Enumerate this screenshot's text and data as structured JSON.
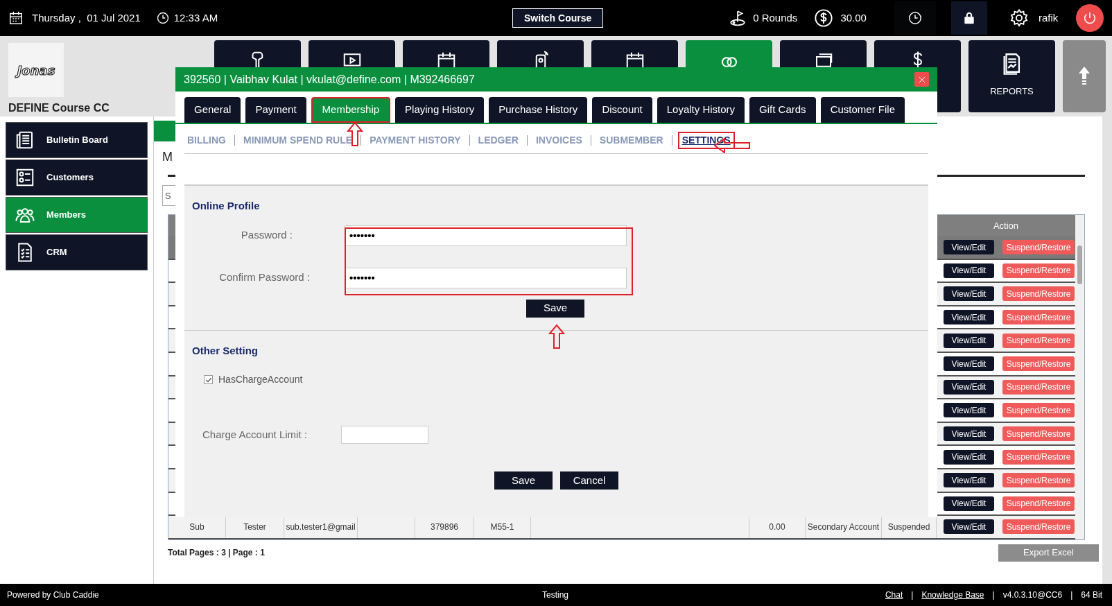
{
  "top_bar": {
    "date": "Thursday ,  01 Jul 2021",
    "time": "12:33 AM",
    "switch_button": "Switch Course",
    "rounds": "0 Rounds",
    "balance": "30.00",
    "user": "rafik"
  },
  "brand": {
    "logo": "Jonas",
    "course_name": "DEFINE Course CC"
  },
  "tiles": [
    {
      "kind": "scanner",
      "selected": false
    },
    {
      "kind": "screen",
      "selected": false
    },
    {
      "kind": "calendar",
      "selected": false
    },
    {
      "kind": "phone",
      "selected": false
    },
    {
      "kind": "calendar",
      "selected": false
    },
    {
      "kind": "rings",
      "selected": true
    },
    {
      "kind": "card",
      "selected": false
    },
    {
      "kind": "dollar",
      "selected": false
    },
    {
      "kind": "reports",
      "label": "REPORTS",
      "selected": false
    }
  ],
  "sidebar": {
    "items": [
      {
        "kind": "board",
        "label": "Bulletin Board",
        "selected": false
      },
      {
        "kind": "customers",
        "label": "Customers",
        "selected": false
      },
      {
        "kind": "members",
        "label": "Members",
        "selected": true
      },
      {
        "kind": "crm",
        "label": "CRM",
        "selected": false
      }
    ]
  },
  "page": {
    "heading": "M",
    "search": {
      "placeholder": "S"
    },
    "table": {
      "action_header": "Action",
      "rows": [
        {
          "selected": true,
          "actions": [
            "View/Edit",
            "Suspend/Restore"
          ]
        },
        {
          "selected": false,
          "actions": [
            "View/Edit",
            "Suspend/Restore"
          ]
        },
        {
          "selected": false,
          "actions": [
            "View/Edit",
            "Suspend/Restore"
          ]
        },
        {
          "selected": false,
          "actions": [
            "View/Edit",
            "Suspend/Restore"
          ]
        },
        {
          "selected": false,
          "actions": [
            "View/Edit",
            "Suspend/Restore"
          ]
        },
        {
          "selected": false,
          "actions": [
            "View/Edit",
            "Suspend/Restore"
          ]
        },
        {
          "selected": false,
          "actions": [
            "View/Edit",
            "Suspend/Restore"
          ]
        },
        {
          "selected": false,
          "actions": [
            "View/Edit",
            "Suspend/Restore"
          ]
        },
        {
          "selected": false,
          "actions": [
            "View/Edit",
            "Suspend/Restore"
          ]
        },
        {
          "selected": false,
          "actions": [
            "View/Edit",
            "Suspend/Restore"
          ]
        },
        {
          "selected": false,
          "actions": [
            "View/Edit",
            "Suspend/Restore"
          ]
        },
        {
          "selected": false,
          "actions": [
            "View/Edit",
            "Suspend/Restore"
          ]
        },
        {
          "selected": false,
          "cells": [
            "Sub",
            "Tester",
            "sub.tester1@gmail",
            null,
            "379896",
            "M55-1",
            null,
            "0.00",
            "Secondary Account",
            "Suspended"
          ],
          "actions": [
            "View/Edit",
            "Suspend/Restore"
          ]
        }
      ]
    },
    "pager": "Total Pages : 3 | Page : 1",
    "export_button": "Export Excel"
  },
  "modal": {
    "title": "392560 | Vaibhav Kulat | vkulat@define.com | M392466697",
    "tabs": [
      {
        "label": "General",
        "selected": false
      },
      {
        "label": "Payment",
        "selected": false
      },
      {
        "label": "Membership",
        "selected": true
      },
      {
        "label": "Playing History",
        "selected": false
      },
      {
        "label": "Purchase History",
        "selected": false
      },
      {
        "label": "Discount",
        "selected": false
      },
      {
        "label": "Loyalty History",
        "selected": false
      },
      {
        "label": "Gift Cards",
        "selected": false
      },
      {
        "label": "Customer File",
        "selected": false
      }
    ],
    "subtabs": [
      {
        "label": "BILLING",
        "selected": false
      },
      {
        "label": "MINIMUM SPEND RULE",
        "selected": false
      },
      {
        "label": "PAYMENT HISTORY",
        "selected": false
      },
      {
        "label": "LEDGER",
        "selected": false
      },
      {
        "label": "INVOICES",
        "selected": false
      },
      {
        "label": "SUBMEMBER",
        "selected": false
      },
      {
        "label": "SETTINGS",
        "selected": true
      }
    ],
    "online_profile": {
      "heading": "Online Profile",
      "password_label": "Password :",
      "password_value": "•••••••",
      "confirm_label": "Confirm Password :",
      "confirm_value": "•••••••",
      "save_button": "Save"
    },
    "other_setting": {
      "heading": "Other Setting",
      "charge_checkbox": {
        "label": "HasChargeAccount",
        "checked": true
      },
      "limit_label": "Charge Account Limit :",
      "save_button": "Save",
      "cancel_button": "Cancel"
    }
  },
  "footer": {
    "left": "Powered by Club Caddie",
    "center": "Testing",
    "right": [
      {
        "kind": "link",
        "text": "Chat"
      },
      {
        "kind": "separator",
        "text": "|"
      },
      {
        "kind": "link",
        "text": "Knowledge Base"
      },
      {
        "kind": "separator",
        "text": "|"
      },
      {
        "kind": "text",
        "text": "v4.0.3.10@CC6"
      },
      {
        "kind": "separator",
        "text": "|"
      },
      {
        "kind": "text",
        "text": "64 Bit"
      }
    ]
  }
}
